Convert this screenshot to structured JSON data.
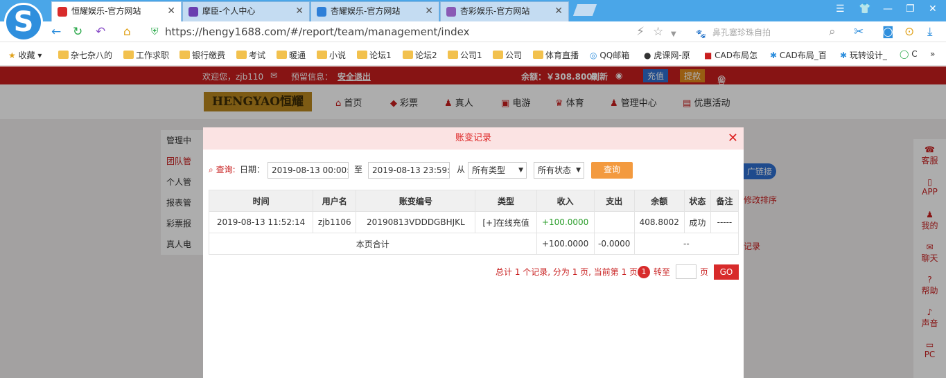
{
  "browser": {
    "tabs": [
      {
        "label": "恒耀娱乐-官方网站",
        "active": true,
        "icon_color": "#d82b2b"
      },
      {
        "label": "摩臣-个人中心",
        "active": false,
        "icon_color": "#6a3fb0"
      },
      {
        "label": "杏耀娱乐-官方网站",
        "active": false,
        "icon_color": "#2e7fd8"
      },
      {
        "label": "杏彩娱乐-官方网站",
        "active": false,
        "icon_color": "#8a5ab5"
      }
    ],
    "url": "https://hengy1688.com/#/report/team/management/index",
    "search_placeholder": "鼻孔塞珍珠自拍",
    "bookmarks": [
      "收藏",
      "杂七杂八的",
      "工作求职",
      "银行缴费",
      "考试",
      "暖通",
      "小说",
      "论坛1",
      "论坛2",
      "公司1",
      "公司",
      "体育直播",
      "QQ邮箱",
      "虎课网-原",
      "CAD布局怎",
      "CAD布局_百",
      "玩转设计_",
      "C"
    ]
  },
  "site": {
    "welcome": "欢迎您，zjb110",
    "notice": "预留信息：",
    "logout": "安全退出",
    "balance": "余额：￥308.8002",
    "refresh": "刷新",
    "recharge": "充值",
    "withdraw": "提款",
    "service": "客服",
    "logo_text": "HENGYAO恒耀",
    "nav": [
      "首页",
      "彩票",
      "真人",
      "电游",
      "体育",
      "管理中心",
      "优惠活动"
    ],
    "left_menu": [
      "管理中",
      "团队管",
      "个人管",
      "报表管",
      "彩票报",
      "真人电"
    ],
    "right_side": [
      "客服",
      "APP",
      "我的",
      "聊天",
      "帮助",
      "声音",
      "PC"
    ],
    "bg_fragments": {
      "promo_link": "广链接",
      "sort": "修改排序",
      "record": "记录"
    }
  },
  "modal": {
    "title": "账变记录",
    "filter": {
      "query_label": "查询:",
      "date_label": "日期：",
      "start_date": "2019-08-13 00:00:00",
      "to_label": "至",
      "end_date": "2019-08-13 23:59:59",
      "from_label": "从",
      "type_select": "所有类型",
      "status_select": "所有状态",
      "query_button": "查询"
    },
    "table": {
      "headers": [
        "时间",
        "用户名",
        "账变编号",
        "类型",
        "收入",
        "支出",
        "余额",
        "状态",
        "备注"
      ],
      "rows": [
        [
          "2019-08-13 11:52:14",
          "zjb1106",
          "20190813VDDDGBHJKL",
          "[+]在线充值",
          "+100.0000",
          "",
          "408.8002",
          "成功",
          "-----"
        ]
      ],
      "summary": {
        "label": "本页合计",
        "income": "+100.0000",
        "expense": "-0.0000",
        "balance": "--"
      }
    },
    "pager": {
      "summary": "总计 1 个记录, 分为 1 页, 当前第 1 页",
      "current_page": "1",
      "goto_label": "转至",
      "page_unit": "页",
      "go_button": "GO"
    }
  }
}
